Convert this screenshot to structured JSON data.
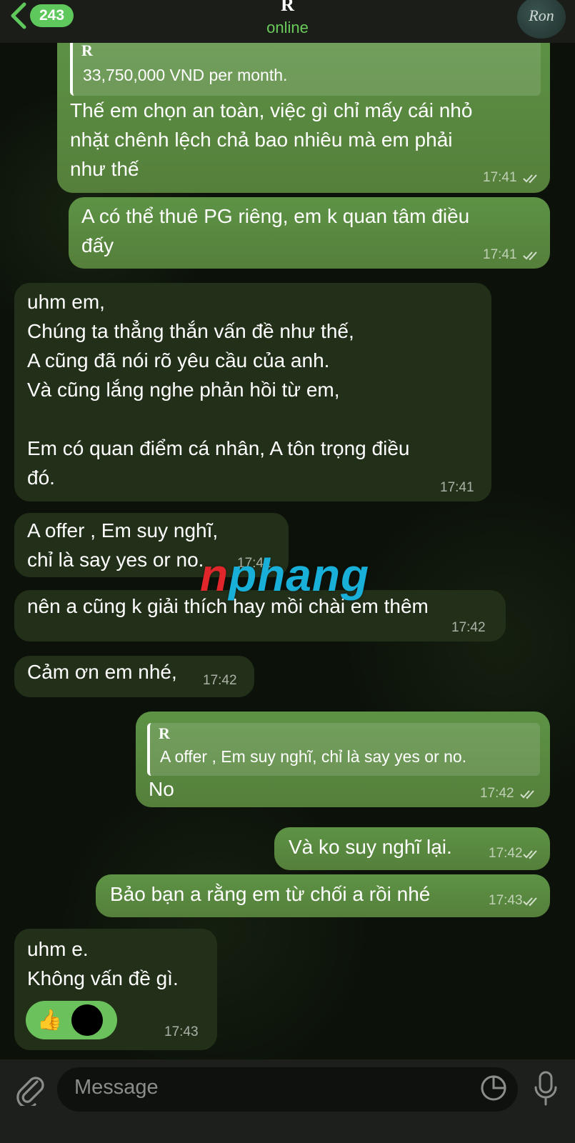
{
  "header": {
    "back_count": "243",
    "title": "R",
    "status": "online",
    "avatar_text": "Ron"
  },
  "messages": [
    {
      "id": "m1",
      "reply_name": "R",
      "reply_text": "33,750,000 VND per month.",
      "text": "Thế em chọn an toàn, việc gì chỉ mấy cái nhỏ\nnhặt chênh lệch chả bao nhiêu mà em phải\nnhư thế",
      "time": "17:41"
    },
    {
      "id": "m2",
      "text": "A có thể thuê PG riêng, em k quan tâm điều\nđấy",
      "time": "17:41"
    },
    {
      "id": "m3",
      "text": "uhm em,\nChúng ta thẳng thắn vấn đề như thế,\nA cũng đã nói rõ yêu cầu của anh.\nVà cũng lắng nghe phản hồi từ em,\n\nEm có quan điểm cá nhân, A tôn trọng điều\nđó.",
      "time": "17:41"
    },
    {
      "id": "m4",
      "text": "A offer , Em suy nghĩ,\nchỉ là say yes or no.",
      "time": "17:42"
    },
    {
      "id": "m5",
      "text": "nên a cũng k giải thích hay mồi chài em thêm",
      "time": "17:42"
    },
    {
      "id": "m6",
      "text": "Cảm ơn em nhé,",
      "time": "17:42"
    },
    {
      "id": "m7",
      "reply_name": "R",
      "reply_text": "A offer , Em suy nghĩ, chỉ là say yes or no.",
      "text": "No",
      "time": "17:42"
    },
    {
      "id": "m8",
      "text": "Và ko suy nghĩ lại.",
      "time": "17:42"
    },
    {
      "id": "m9",
      "text": "Bảo bạn a rằng em từ chối a rồi nhé",
      "time": "17:43"
    },
    {
      "id": "m10",
      "text": "uhm e.\nKhông vấn đề gì.",
      "time": "17:43",
      "reaction": "👍"
    }
  ],
  "watermark": {
    "first": "n",
    "rest": "phang"
  },
  "input": {
    "placeholder": "Message"
  },
  "icons": {
    "back": "chevron-left-icon",
    "attach": "paperclip-icon",
    "sticker": "sticker-icon",
    "mic": "microphone-icon",
    "read": "double-check-icon"
  },
  "colors": {
    "outgoing": "#5a8a3e",
    "incoming": "#233019",
    "accent": "#5fc85c"
  }
}
